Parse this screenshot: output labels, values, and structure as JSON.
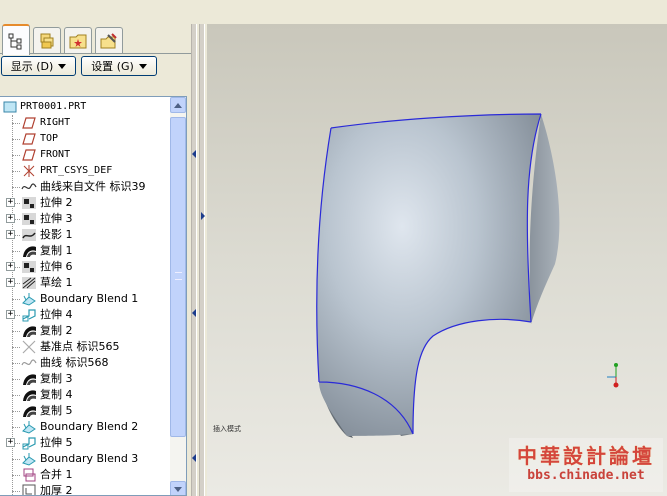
{
  "toolbar": {
    "show_label": "显示",
    "show_key": "(D)",
    "settings_label": "设置",
    "settings_key": "(G)"
  },
  "tabs": [
    {
      "icon": "model-tree-icon"
    },
    {
      "icon": "folder-browser-icon"
    },
    {
      "icon": "favorites-icon"
    },
    {
      "icon": "connections-icon"
    }
  ],
  "tree": [
    {
      "label": "PRT0001.PRT",
      "icon": "part-icon",
      "expandable": false
    },
    {
      "label": "RIGHT",
      "icon": "datum-plane-icon",
      "expandable": false
    },
    {
      "label": "TOP",
      "icon": "datum-plane-icon",
      "expandable": false
    },
    {
      "label": "FRONT",
      "icon": "datum-plane-icon",
      "expandable": false
    },
    {
      "label": "PRT_CSYS_DEF",
      "icon": "csys-icon",
      "expandable": false
    },
    {
      "label": "曲线来自文件 标识39",
      "icon": "curve-icon",
      "expandable": false
    },
    {
      "label": "拉伸 2",
      "icon": "extrude-icon",
      "expandable": true
    },
    {
      "label": "拉伸 3",
      "icon": "extrude-icon",
      "expandable": true
    },
    {
      "label": "投影 1",
      "icon": "project-icon",
      "expandable": true
    },
    {
      "label": "复制 1",
      "icon": "copy-icon",
      "expandable": false
    },
    {
      "label": "拉伸 6",
      "icon": "extrude-icon",
      "expandable": true
    },
    {
      "label": "草绘 1",
      "icon": "sketch-icon",
      "expandable": true
    },
    {
      "label": "Boundary Blend 1",
      "icon": "boundary-blend-icon",
      "expandable": false
    },
    {
      "label": "拉伸 4",
      "icon": "extrude-surface-icon",
      "expandable": true
    },
    {
      "label": "复制 2",
      "icon": "copy-icon",
      "expandable": false
    },
    {
      "label": "基准点 标识565",
      "icon": "datum-point-icon",
      "expandable": false
    },
    {
      "label": "曲线 标识568",
      "icon": "curve-gray-icon",
      "expandable": false
    },
    {
      "label": "复制 3",
      "icon": "copy-icon",
      "expandable": false
    },
    {
      "label": "复制 4",
      "icon": "copy-icon",
      "expandable": false
    },
    {
      "label": "复制 5",
      "icon": "copy-icon",
      "expandable": false
    },
    {
      "label": "Boundary Blend 2",
      "icon": "boundary-blend-icon",
      "expandable": false
    },
    {
      "label": "拉伸 5",
      "icon": "extrude-surface-icon",
      "expandable": true
    },
    {
      "label": "Boundary Blend 3",
      "icon": "boundary-blend-icon",
      "expandable": false
    },
    {
      "label": "合并 1",
      "icon": "merge-icon",
      "expandable": false
    },
    {
      "label": "加厚 2",
      "icon": "thicken-icon",
      "expandable": false
    }
  ],
  "graphics": {
    "status_text": "插入模式",
    "model_edge_color": "#2a2ad8",
    "background_top": "#c9c7bb",
    "background_bottom": "#ebeae4"
  },
  "watermark": {
    "chinese": "中華設計論壇",
    "url": "bbs.chinade.net"
  }
}
